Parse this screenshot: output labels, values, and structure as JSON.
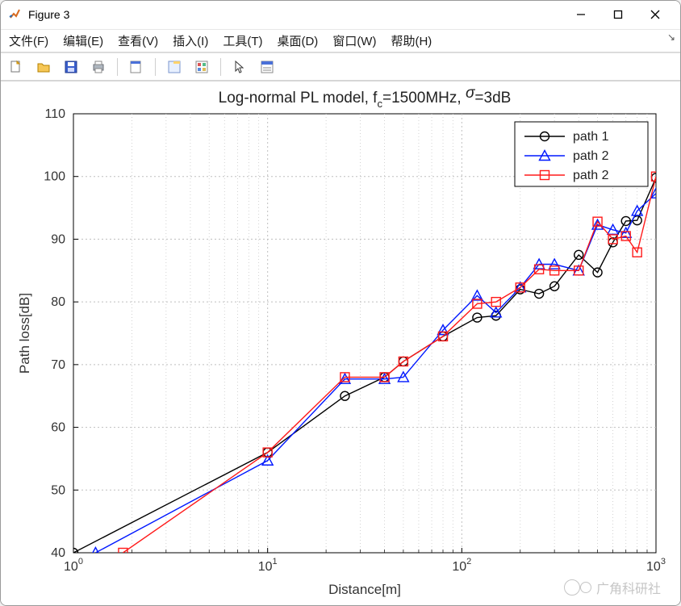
{
  "window": {
    "title": "Figure 3"
  },
  "menu": {
    "items": [
      "文件(F)",
      "编辑(E)",
      "查看(V)",
      "插入(I)",
      "工具(T)",
      "桌面(D)",
      "窗口(W)",
      "帮助(H)"
    ]
  },
  "toolbar": {
    "icons": [
      "new-file-icon",
      "open-file-icon",
      "save-icon",
      "print-icon",
      "|",
      "print-preview-icon",
      "|",
      "datatip-icon",
      "colorbar-icon",
      "|",
      "pointer-icon",
      "insert-legend-icon"
    ]
  },
  "watermark": {
    "text": "广角科研社"
  },
  "chart_data": {
    "type": "line",
    "title": "Log-normal PL model, f_c=1500MHz, σ=3dB",
    "xlabel": "Distance[m]",
    "ylabel": "Path loss[dB]",
    "xscale": "log",
    "xlim": [
      1,
      1000
    ],
    "ylim": [
      40,
      110
    ],
    "yticks": [
      40,
      50,
      60,
      70,
      80,
      90,
      100,
      110
    ],
    "xticks": [
      1,
      10,
      100,
      1000
    ],
    "xtick_labels": [
      "10^0",
      "10^1",
      "10^2",
      "10^3"
    ],
    "grid": {
      "major": true,
      "minor": true,
      "style": "dashed"
    },
    "legend": {
      "position": "upper-right",
      "entries": [
        "path 1",
        "path 2",
        "path 2"
      ]
    },
    "series": [
      {
        "name": "path 1",
        "color": "#000000",
        "marker": "circle",
        "x": [
          1,
          10,
          25,
          40,
          50,
          80,
          120,
          150,
          200,
          250,
          300,
          400,
          500,
          600,
          700,
          800,
          1000
        ],
        "y": [
          40,
          56,
          65,
          68,
          70.5,
          74.5,
          77.5,
          77.8,
          82,
          81.3,
          82.5,
          87.5,
          84.7,
          89.5,
          92.9,
          93,
          99.8
        ]
      },
      {
        "name": "path 2",
        "color": "#0018ff",
        "marker": "triangle",
        "x": [
          1.3,
          10,
          25,
          40,
          50,
          80,
          120,
          150,
          200,
          250,
          300,
          400,
          500,
          600,
          700,
          800,
          1000
        ],
        "y": [
          40,
          54.7,
          67.7,
          67.7,
          68,
          75.5,
          81,
          78.3,
          82.3,
          86,
          86,
          85,
          92.3,
          91.5,
          91,
          94.5,
          97.3
        ]
      },
      {
        "name": "path 2",
        "color": "#ff1a1a",
        "marker": "square",
        "x": [
          1.8,
          10,
          25,
          40,
          50,
          80,
          120,
          150,
          200,
          250,
          300,
          400,
          500,
          600,
          700,
          800,
          1000
        ],
        "y": [
          40,
          56,
          68,
          68,
          70.5,
          74.5,
          79.7,
          80,
          82.3,
          85.2,
          85,
          85,
          92.8,
          90,
          90.5,
          87.9,
          100
        ]
      }
    ]
  }
}
